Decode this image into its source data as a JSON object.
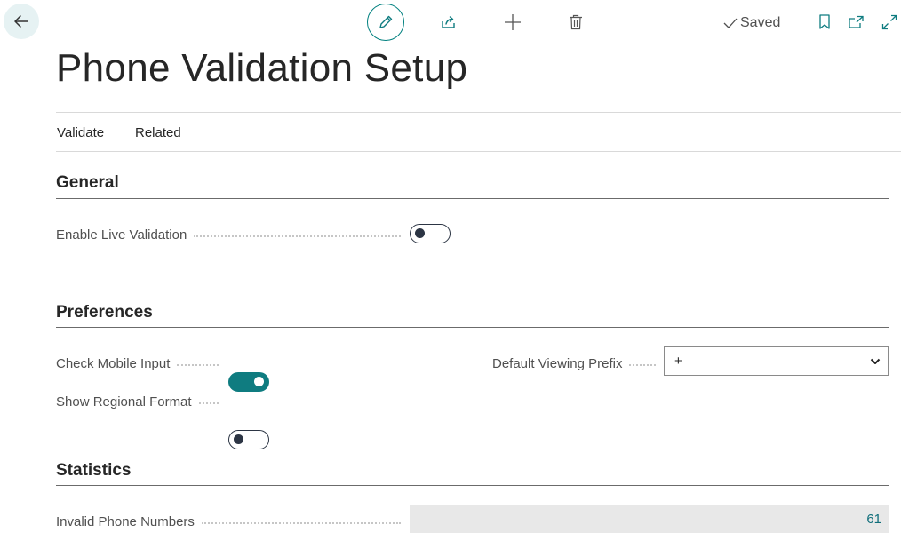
{
  "toolbar": {
    "back_icon": "arrow-left-icon",
    "edit_icon": "pencil-icon",
    "share_icon": "share-icon",
    "new_icon": "plus-icon",
    "delete_icon": "trash-icon",
    "saved_label": "Saved",
    "bookmark_icon": "bookmark-icon",
    "open_new_window_icon": "open-in-new-icon",
    "expand_icon": "expand-icon"
  },
  "page": {
    "title": "Phone Validation Setup"
  },
  "actions": {
    "validate": "Validate",
    "related": "Related"
  },
  "sections": {
    "general": {
      "title": "General",
      "enable_live_validation": {
        "label": "Enable Live Validation",
        "checked": false
      }
    },
    "preferences": {
      "title": "Preferences",
      "check_mobile_input": {
        "label": "Check Mobile Input",
        "checked": true
      },
      "show_regional_format": {
        "label": "Show Regional Format",
        "checked": false
      },
      "default_viewing_prefix": {
        "label": "Default Viewing Prefix",
        "value": "+"
      }
    },
    "statistics": {
      "title": "Statistics",
      "invalid_phone_numbers": {
        "label": "Invalid Phone Numbers",
        "value": "61"
      }
    }
  },
  "colors": {
    "accent": "#0f7c80",
    "toggle_off": "#2c3544",
    "stat_value": "#0f6e7a"
  }
}
